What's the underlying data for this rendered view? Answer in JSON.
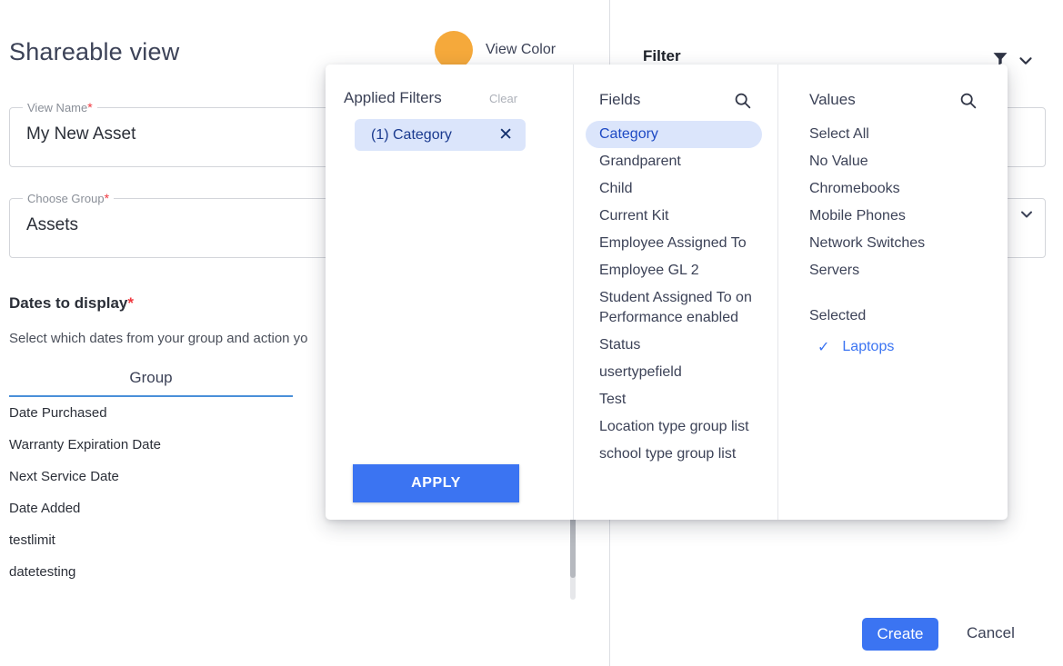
{
  "page": {
    "title": "Shareable view",
    "view_color_label": "View Color",
    "view_color_hex": "#F5A93B"
  },
  "form": {
    "view_name": {
      "label": "View Name",
      "required": "*",
      "value": "My New Asset"
    },
    "choose_group": {
      "label": "Choose Group",
      "required": "*",
      "value": "Assets"
    }
  },
  "dates_section": {
    "title": "Dates to display",
    "required": "*",
    "subtitle": "Select which dates from your group and action yo",
    "column_header": "Group",
    "rows": [
      "Date Purchased",
      "Warranty Expiration Date",
      "Next Service Date",
      "Date Added",
      "testlimit",
      "datetesting"
    ],
    "toggles": [
      {
        "state": "off",
        "glyph": "✕"
      },
      {
        "state": "off",
        "glyph": "✕"
      },
      {
        "state": "off",
        "glyph": "✕"
      }
    ]
  },
  "filter_header": {
    "title": "Filter",
    "funnel_icon": "funnel-icon",
    "chevron_icon": "chevron-down-icon"
  },
  "popup": {
    "applied": {
      "title": "Applied Filters",
      "clear_label": "Clear",
      "chips": [
        {
          "label": "(1) Category",
          "close_glyph": "✕"
        }
      ],
      "apply_label": "APPLY"
    },
    "fields": {
      "title": "Fields",
      "search_icon": "search-icon",
      "items": [
        "Category",
        "Grandparent",
        "Child",
        "Current Kit",
        "Employee Assigned To",
        "Employee GL 2",
        "Student Assigned To on Performance enabled",
        "Status",
        "usertypefield",
        "Test",
        "Location type group list",
        "school type group list"
      ],
      "selected_index": 0
    },
    "values": {
      "title": "Values",
      "search_icon": "search-icon",
      "items": [
        "Select All",
        "No Value",
        "Chromebooks",
        "Mobile Phones",
        "Network Switches",
        "Servers"
      ],
      "selected_header": "Selected",
      "selected_items": [
        {
          "label": "Laptops",
          "check_glyph": "✓"
        }
      ]
    }
  },
  "footer": {
    "create_label": "Create",
    "cancel_label": "Cancel"
  },
  "colors": {
    "primary_blue": "#3B74F2",
    "chip_bg": "#DBE5FB",
    "required_red": "#F0383F"
  }
}
